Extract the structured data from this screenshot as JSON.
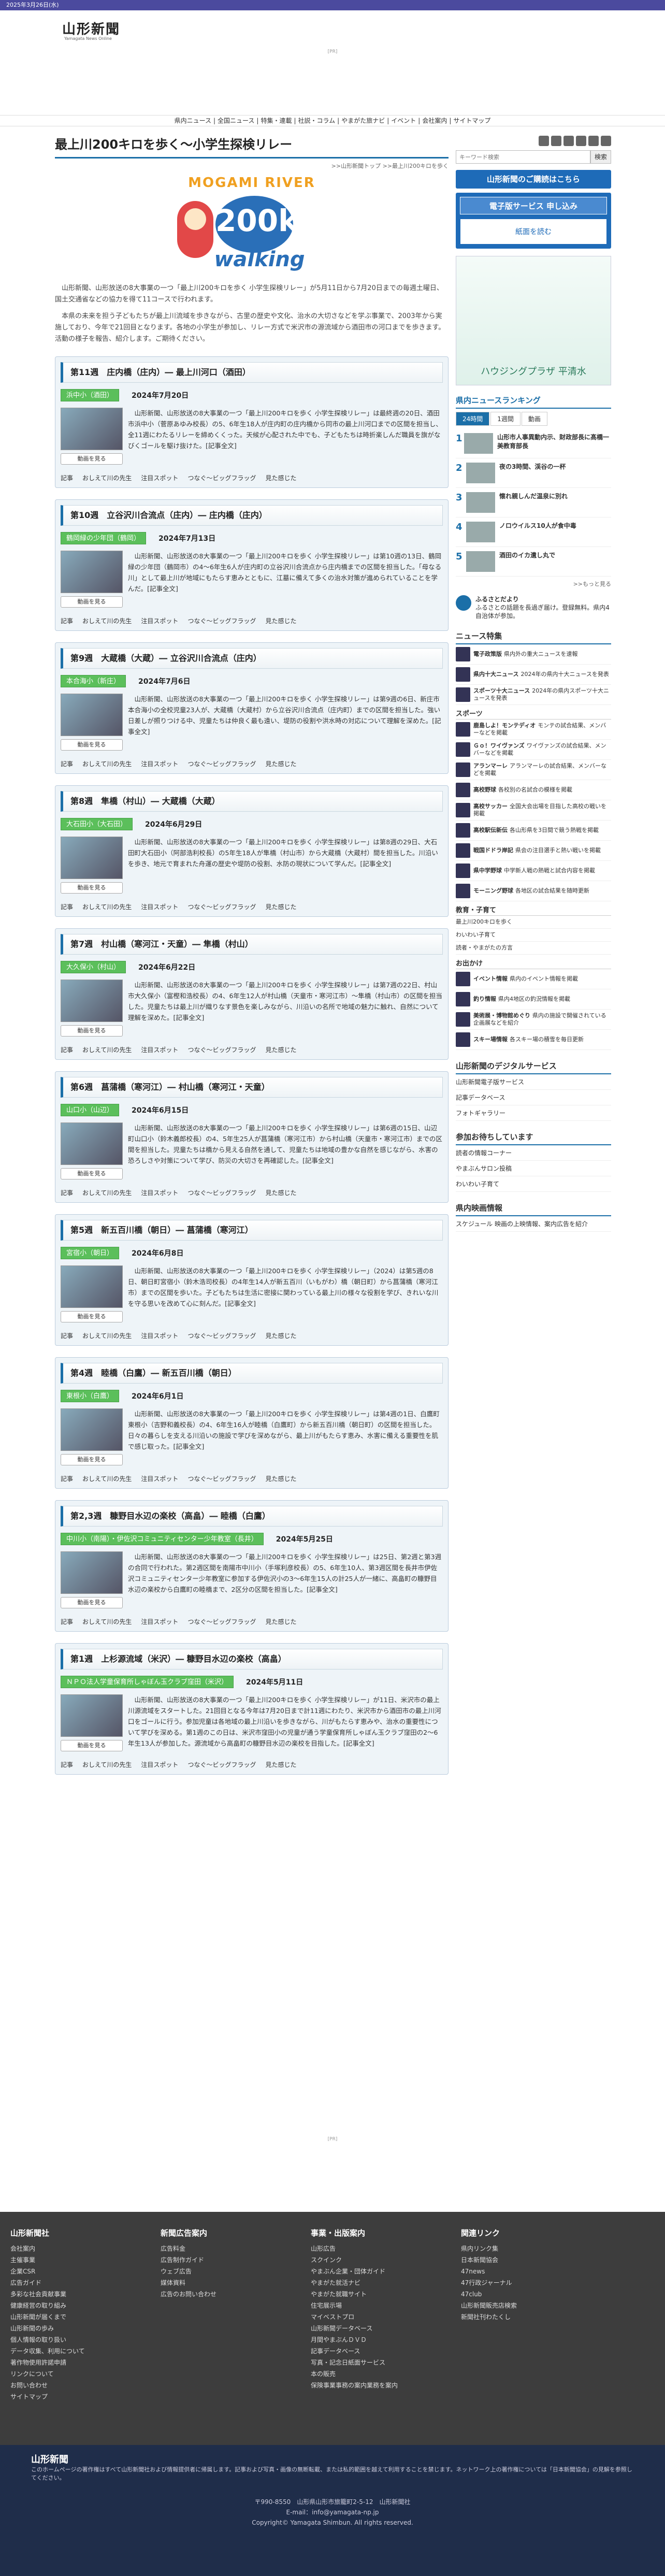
{
  "topbar": "2025年3月26日(水)",
  "brand": {
    "name": "山形新聞",
    "sub": "Yamagata News Online"
  },
  "ad_label": "[PR]",
  "nav": [
    "県内ニュース",
    "全国ニュース",
    "特集・連載",
    "社説・コラム",
    "やまがた旅ナビ",
    "イベント",
    "会社案内",
    "サイトマップ"
  ],
  "page": {
    "title": "最上川200キロを歩く～小学生探検リレー",
    "breadcrumb": ">>山形新聞トップ >>最上川200キロを歩く"
  },
  "hero": {
    "top": "MOGAMI RIVER",
    "num": "200km",
    "walk": "walking"
  },
  "intro": [
    "山形新聞、山形放送の8大事業の一つ「最上川200キロを歩く 小学生探検リレー」が5月11日から7月20日までの毎週土曜日、国土交通省などの協力を得て11コースで行われます。",
    "本県の未来を担う子どもたちが最上川流域を歩きながら、古里の歴史や文化、治水の大切さなどを学ぶ事業で、2003年から実施しており、今年で21回目となります。各地の小学生が参加し、リレー方式で米沢市の源流域から酒田市の河口までを歩きます。活動の様子を報告、紹介します。ご期待ください。"
  ],
  "links": [
    "記事",
    "おしえて川の先生",
    "注目スポット",
    "つなぐ～ビッグフラッグ",
    "見た感じた"
  ],
  "video_label": "動画を見る",
  "sections": [
    {
      "title": "第11週　庄内橋（庄内）― 最上川河口（酒田）",
      "loc": "浜中小（酒田）",
      "date": "2024年7月20日",
      "desc": "山形新聞、山形放送の8大事業の一つ「最上川200キロを歩く 小学生探検リレー」は最終週の20日、酒田市浜中小（菅原あゆみ校長）の5、6年生18人が庄内町の庄内橋から同市の最上川河口までの区間を担当し、全11週にわたるリレーを締めくくった。天候が心配された中でも、子どもたちは時折楽しんだ職員を旗がなびくゴールを駆け抜けた。[記事全文]"
    },
    {
      "title": "第10週　立谷沢川合流点（庄内）― 庄内橋（庄内）",
      "loc": "鶴岡緑の少年団（鶴岡）",
      "date": "2024年7月13日",
      "desc": "山形新聞、山形放送の8大事業の一つ「最上川200キロを歩く 小学生探検リレー」は第10週の13日、鶴岡緑の少年団（鶴岡市）の4～6年生6人が庄内町の立谷沢川合流点から庄内橋までの区間を担当した。「母なる川」として最上川が地域にもたらす恵みとともに、江墓に備えて多くの治水対策が進められていることを学んだ。[記事全文]"
    },
    {
      "title": "第9週　大蔵橋（大蔵）― 立谷沢川合流点（庄内）",
      "loc": "本合海小（新庄）",
      "date": "2024年7月6日",
      "desc": "山形新聞、山形放送の8大事業の一つ「最上川200キロを歩く 小学生探検リレー」は第9週の6日、新庄市本合海小の全校児童23人が、大蔵橋（大蔵村）から立谷沢川合流点（庄内町）までの区間を担当した。強い日差しが照りつける中、児童たちは仲良く最も遠い、堤防の役割や洪水時の対応について理解を深めた。[記事全文]"
    },
    {
      "title": "第8週　隼橋（村山）― 大蔵橋（大蔵）",
      "loc": "大石田小（大石田）",
      "date": "2024年6月29日",
      "desc": "山形新聞、山形放送の8大事業の一つ「最上川200キロを歩く 小学生探検リレー」は第8週の29日、大石田町大石田小（阿部浩利校長）の5年生18人が隼橋（村山市）から大蔵橋（大蔵村）間を担当した。川沿いを歩き、地元で育まれた舟運の歴史や堤防の役割、水防の現状について学んだ。[記事全文]"
    },
    {
      "title": "第7週　村山橋（寒河江・天童）― 隼橋（村山）",
      "loc": "大久保小（村山）",
      "date": "2024年6月22日",
      "desc": "山形新聞、山形放送の8大事業の一つ「最上川200キロを歩く 小学生探検リレー」は第7週の22日、村山市大久保小（富樫和浩校長）の4、6年生12人が村山橋（天童市・寒河江市）～隼橋（村山市）の区間を担当した。児童たちは最上川が織りなす景色を楽しみながら、川沿いの名所で地域の魅力に触れ、自然について理解を深めた。[記事全文]"
    },
    {
      "title": "第6週　菖蒲橋（寒河江）― 村山橋（寒河江・天童）",
      "loc": "山口小（山辺）",
      "date": "2024年6月15日",
      "desc": "山形新聞、山形放送の8大事業の一つ「最上川200キロを歩く 小学生探検リレー」は第6週の15日、山辺町山口小（鈴木義郎校長）の4、5年生25人が菖蒲橋（寒河江市）から村山橋（天童市・寒河江市）までの区間を担当した。児童たちは橋から見える自然を通して、児童たちは地域の豊かな自然を感じながら、水害の恐ろしさや対策について学び、防災の大切さを再確認した。[記事全文]"
    },
    {
      "title": "第5週　新五百川橋（朝日）― 菖蒲橋（寒河江）",
      "loc": "宮宿小（朝日）",
      "date": "2024年6月8日",
      "desc": "山形新聞、山形放送の8大事業の一つ「最上川200キロを歩く 小学生探検リレー」（2024）は第5週の8日、朝日町宮宿小（鈴木浩司校長）の4年生14人が新五百川（いもがわ）橋（朝日町）から菖蒲橋（寒河江市）までの区間を歩いた。子どもたちは生活に密接に関わっている最上川の様々な役割を学び、きれいな川を守る思いを改めて心に刻んだ。[記事全文]"
    },
    {
      "title": "第4週　睦橋（白鷹）― 新五百川橋（朝日）",
      "loc": "東根小（白鷹）",
      "date": "2024年6月1日",
      "desc": "山形新聞、山形放送の8大事業の一つ「最上川200キロを歩く 小学生探検リレー」は第4週の1日、白鷹町東根小（吉野和義校長）の4、6年生16人が睦橋（白鷹町）から新五百川橋（朝日町）の区間を担当した。日々の暮らしを支える川沿いの施設で学びを深めながら、最上川がもたらす恵み、水害に備える重要性を肌で感じ取った。[記事全文]"
    },
    {
      "title": "第2,3週　糠野目水辺の楽校（高畠）― 睦橋（白鷹）",
      "loc": "中川小（南陽）・伊佐沢コミュニティセンター少年教室（長井）",
      "date": "2024年5月25日",
      "desc": "山形新聞、山形放送の8大事業の一つ「最上川200キロを歩く 小学生探検リレー」は25日、第2週と第3週の合同で行われた。第2週区間を南陽市中川小（手塚利彦校長）の5、6年生10人、第3週区間を長井市伊佐沢コミュニティセンター少年教室に参加する伊佐沢小の3～6年生15人の計25人が一緒に、高畠町の糠野目水辺の楽校から白鷹町の睦橋まで、2区分の区間を担当した。[記事全文]"
    },
    {
      "title": "第1週　上杉源流域（米沢）― 糠野目水辺の楽校（高畠）",
      "loc": "ＮＰＯ法人学童保育所しゃぼん玉クラブ窪田（米沢）",
      "date": "2024年5月11日",
      "desc": "山形新聞、山形放送の8大事業の一つ「最上川200キロを歩く 小学生探検リレー」が11日、米沢市の最上川源流域をスタートした。21回目となる今年は7月20日まで計11週にわたり、米沢市から酒田市の最上川河口をゴールに行う。参加児童は各地域の最上川沿いを歩きながら、川がもたらす恵みや、治水の重要性について学びを深める。第1週のこの日は、米沢市窪田小の児童が通う学童保育所しゃぼん玉クラブ窪田の2～6年生13人が参加した。源流域から高畠町の糠野目水辺の楽校を目指した。[記事全文]"
    }
  ],
  "sidebar": {
    "search_placeholder": "キーワード検索",
    "search_btn": "検索",
    "apply": "山形新聞のご購読はこちら",
    "e_service": "電子版サービス 申し込み",
    "read_paper": "紙面を読む",
    "ad": "ハウジングプラザ 平清水",
    "ranking_title": "県内ニュースランキング",
    "tabs": [
      "24時間",
      "1週間",
      "動画"
    ],
    "ranking": [
      "山形市人事異動内示、財政部長に髙橋一美教育部長",
      "夜の3時間、渓谷の一杯",
      "懐れ親しんだ温泉に別れ",
      "ノロウイルス10人が食中毒",
      "酒田のイカ遺し丸で"
    ],
    "more": ">>もっと見る",
    "furusato_title": "ふるさとだより",
    "furusato_text": "ふるさとの話題を長過ぎ届け。登録無料。県内4自治体が参加。",
    "special_title": "ニュース特集",
    "special": [
      [
        "電子政策版",
        "県内外の重大ニュースを速報"
      ],
      [
        "県内十大ニュース",
        "2024年の県内十大ニュースを発表"
      ],
      [
        "スポーツ十大ニュース",
        "2024年の県内スポーツ十大ニュースを発表"
      ]
    ],
    "sports_title": "スポーツ",
    "sports": [
      [
        "鹿島しよ！モンテディオ",
        "モンテの試合結果、メンバーなどを掲載"
      ],
      [
        "Ｇｏ！ワイヴァンズ",
        "ワイヴァンズの試合結果、メンバーなどを掲載"
      ],
      [
        "アランマーレ",
        "アランマーレの試合結果、メンバーなどを掲載"
      ],
      [
        "高校野球",
        "各校別の名試合の模様を掲載"
      ],
      [
        "高校サッカー",
        "全国大会出場を目指した高校の戦いを掲載"
      ],
      [
        "高校駅伝新伝",
        "各山形県を3日間で競う熱戦を掲載"
      ],
      [
        "戦国ドドラ岸記",
        "県会の注目選手と熱い戦いを掲載"
      ],
      [
        "県中学野球",
        "中学新人戦の熱戦と試合内容を掲載"
      ],
      [
        "モーニング野球",
        "各地区の試合結果を随時更新"
      ]
    ],
    "edu_title": "教育・子育て",
    "edu": [
      "最上川200キロを歩く",
      "わいわい子育て",
      "読者・やまがたの方言"
    ],
    "outing_title": "お出かけ",
    "outing": [
      [
        "イベント情報",
        "県内のイベント情報を掲載"
      ],
      [
        "釣り情報",
        "県内4地区の釣況情報を掲載"
      ],
      [
        "美術展・博物館めぐり",
        "県内の施設で開催されている企画展などを紹介"
      ],
      [
        "スキー場情報",
        "各スキー場の積雪を毎日更新"
      ]
    ],
    "digital_title": "山形新聞のデジタルサービス",
    "digital": [
      "山形新聞電子版サービス",
      "記事データベース",
      "フォトギャラリー"
    ],
    "join_title": "参加お待ちしています",
    "join": [
      "読者の情報コーナー",
      "やまぶんサロン投稿",
      "わいわい子育て"
    ],
    "inhouse_title": "県内映画情報",
    "inhouse": "スケジュール 映画の上映情報、案内広告を紹介"
  },
  "footer": {
    "cols": [
      {
        "h": "山形新聞社",
        "items": [
          "会社案内",
          "主催事業",
          "企業CSR",
          "広告ガイド",
          "多彩な社会貢献事業",
          "健康経営の取り組み",
          "山形新聞が届くまで",
          "山形新聞の歩み",
          "個人情報の取り扱い",
          "データ収集、利用について",
          "著作物使用許諾申請",
          "リンクについて",
          "お問い合わせ",
          "サイトマップ"
        ]
      },
      {
        "h": "新聞広告案内",
        "items": [
          "広告料金",
          "広告制作ガイド",
          "ウェブ広告",
          "媒体資料",
          "広告のお問い合わせ"
        ]
      },
      {
        "h": "事業・出版案内",
        "items": [
          "山形広告",
          "スクインク",
          "やまぶん企業・団体ガイド",
          "やまがた就活ナビ",
          "やまがた就職サイト",
          "住宅展示場",
          "マイベストプロ",
          "山形新聞データベース",
          "月間やまぶんＤＶＤ",
          "記事データベース",
          "写真・記念日紙面サービス",
          "本の販売",
          "保険事業事務の案内業務を案内"
        ]
      },
      {
        "h": "関連リンク",
        "items": [
          "県内リンク集",
          "日本新聞協会",
          "47news",
          "47行政ジャーナル",
          "47club",
          "山形新聞販売店検索",
          "新聞社刊わたくし"
        ]
      }
    ],
    "notice": "このホームページの著作権はすべて山形新聞社および情報提供者に帰属します。記事および写真・画像の無断転載、または私的範囲を越えて利用することを禁じます。ネットワーク上の著作権については「日本新聞協会」の見解を参照してください。",
    "address": "〒990-8550　山形県山形市旅籠町2-5-12　山形新聞社",
    "email": "E-mail：info@yamagata-np.jp",
    "copyright": "Copyright© Yamagata Shimbun. All rights reserved."
  }
}
